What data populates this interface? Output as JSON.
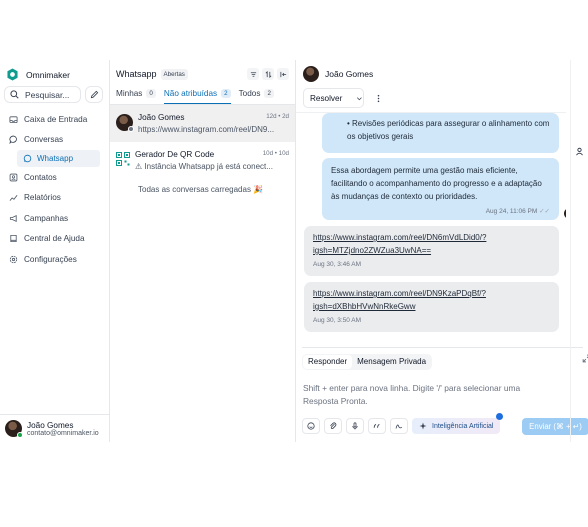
{
  "sidebar": {
    "brand": "Omnimaker",
    "search_placeholder": "Pesquisar...",
    "items": [
      {
        "label": "Caixa de Entrada",
        "icon": "inbox-icon"
      },
      {
        "label": "Conversas",
        "icon": "chat-bubble-icon"
      },
      {
        "label": "Contatos",
        "icon": "contacts-icon"
      },
      {
        "label": "Relatórios",
        "icon": "chart-icon"
      },
      {
        "label": "Campanhas",
        "icon": "megaphone-icon"
      },
      {
        "label": "Central de Ajuda",
        "icon": "book-icon"
      },
      {
        "label": "Configurações",
        "icon": "gear-icon"
      }
    ],
    "sub_item": "Whatsapp",
    "user": {
      "name": "João Gomes",
      "email": "contato@omnimaker.io"
    }
  },
  "list": {
    "title": "Whatsapp",
    "status_badge": "Abertas",
    "tabs": [
      {
        "label": "Minhas",
        "count": "0"
      },
      {
        "label": "Não atribuídas",
        "count": "2"
      },
      {
        "label": "Todos",
        "count": "2"
      }
    ],
    "conversations": [
      {
        "name": "João Gomes",
        "time": "12d • 2d",
        "preview": "https://www.instagram.com/reel/DN9..."
      },
      {
        "name": "Gerador De QR Code",
        "time": "10d • 10d",
        "preview": "⚠ Instância Whatsapp já está conect..."
      }
    ],
    "all_loaded": "Todas as conversas carregadas 🎉"
  },
  "chat": {
    "contact_name": "João Gomes",
    "resolve_label": "Resolver",
    "messages": [
      {
        "type": "out",
        "lines": [
          "• Revisões periódicas para assegurar o alinhamento com",
          "os objetivos gerais"
        ]
      },
      {
        "type": "out",
        "lines": [
          "Essa abordagem permite uma gestão mais eficiente,",
          "facilitando o acompanhamento do progresso e a adaptação",
          "às mudanças de contexto ou prioridades."
        ],
        "meta": "Aug 24, 11:06 PM"
      },
      {
        "type": "in",
        "link1": "https://www.instagram.com/reel/DN6mVdLDid0/?",
        "link2": "igsh=MTZjdno2ZWZua3UwNA==",
        "meta": "Aug 30, 3:46 AM"
      },
      {
        "type": "in",
        "link1": "https://www.instagram.com/reel/DN9KzaPDqBf/?",
        "link2": "igsh=dXBhbHVwNnRkeGww",
        "meta": "Aug 30, 3:50 AM"
      }
    ],
    "composer": {
      "tab_reply": "Responder",
      "tab_private": "Mensagem Privada",
      "placeholder_line1": "Shift + enter para nova linha. Digite '/' para selecionar uma",
      "placeholder_line2": "Resposta Pronta.",
      "ai_label": "Inteligência Artificial",
      "send_label": "Enviar (⌘ + ↵)"
    }
  },
  "colors": {
    "accent": "#0b6fb6",
    "outgoing_bubble": "#cfe7f9",
    "incoming_bubble": "#ebecee",
    "send_button": "#9ccbf3",
    "online": "#16a34a"
  }
}
